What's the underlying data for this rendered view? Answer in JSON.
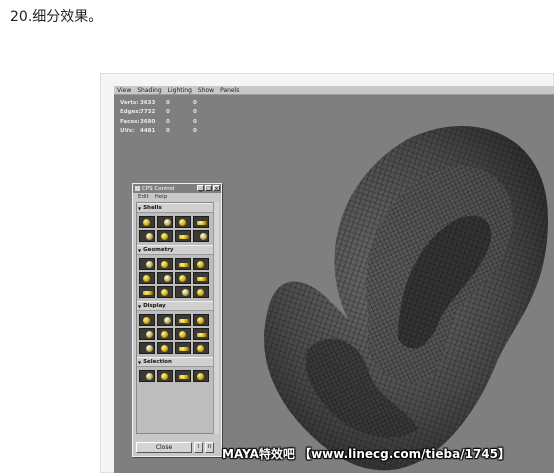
{
  "caption": "20.细分效果。",
  "viewport_menu": [
    "View",
    "Shading",
    "Lighting",
    "Show",
    "Panels"
  ],
  "hud": [
    {
      "label": "Verts:",
      "v1": "3633",
      "v2": "0",
      "v3": "0"
    },
    {
      "label": "Edges:",
      "v1": "7732",
      "v2": "0",
      "v3": "0"
    },
    {
      "label": "Faces:",
      "v1": "3680",
      "v2": "0",
      "v3": "0"
    },
    {
      "label": "UVs:",
      "v1": "4481",
      "v2": "0",
      "v3": "0"
    }
  ],
  "cps": {
    "title": "CPS Control",
    "menu": [
      "Edit",
      "Help"
    ],
    "sections": [
      "Shells",
      "Geometry",
      "Display",
      "Selection"
    ],
    "close_label": "Close",
    "btn1": "I",
    "btn2": "II"
  },
  "watermark": "MAYA特效吧 【www.linecg.com/tieba/1745】",
  "colors": {
    "viewport_bg": "#7f7f7f",
    "mesh_fill": "#3d3d3d",
    "wire": "#111111"
  }
}
